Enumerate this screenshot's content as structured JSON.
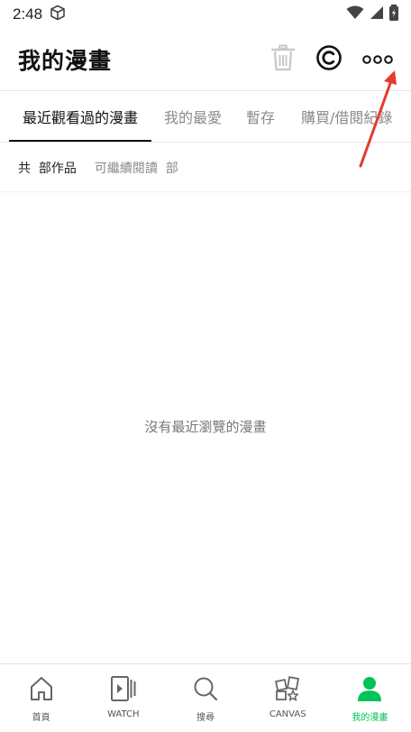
{
  "status": {
    "time": "2:48"
  },
  "header": {
    "title": "我的漫畫"
  },
  "tabs": [
    {
      "label": "最近觀看過的漫畫",
      "active": true
    },
    {
      "label": "我的最愛",
      "active": false
    },
    {
      "label": "暫存",
      "active": false
    },
    {
      "label": "購買/借閱紀錄",
      "active": false
    }
  ],
  "subinfo": {
    "count_text": "共  部作品",
    "continue_text": "可繼續閱讀  部"
  },
  "empty_message": "沒有最近瀏覽的漫畫",
  "bottom_nav": [
    {
      "label": "首頁",
      "icon": "home-icon",
      "active": false
    },
    {
      "label": "WATCH",
      "icon": "watch-icon",
      "active": false
    },
    {
      "label": "搜尋",
      "icon": "search-icon",
      "active": false
    },
    {
      "label": "CANVAS",
      "icon": "canvas-icon",
      "active": false
    },
    {
      "label": "我的漫畫",
      "icon": "profile-icon",
      "active": true
    }
  ],
  "colors": {
    "accent": "#00c35a",
    "annotation": "#e53b2c"
  }
}
